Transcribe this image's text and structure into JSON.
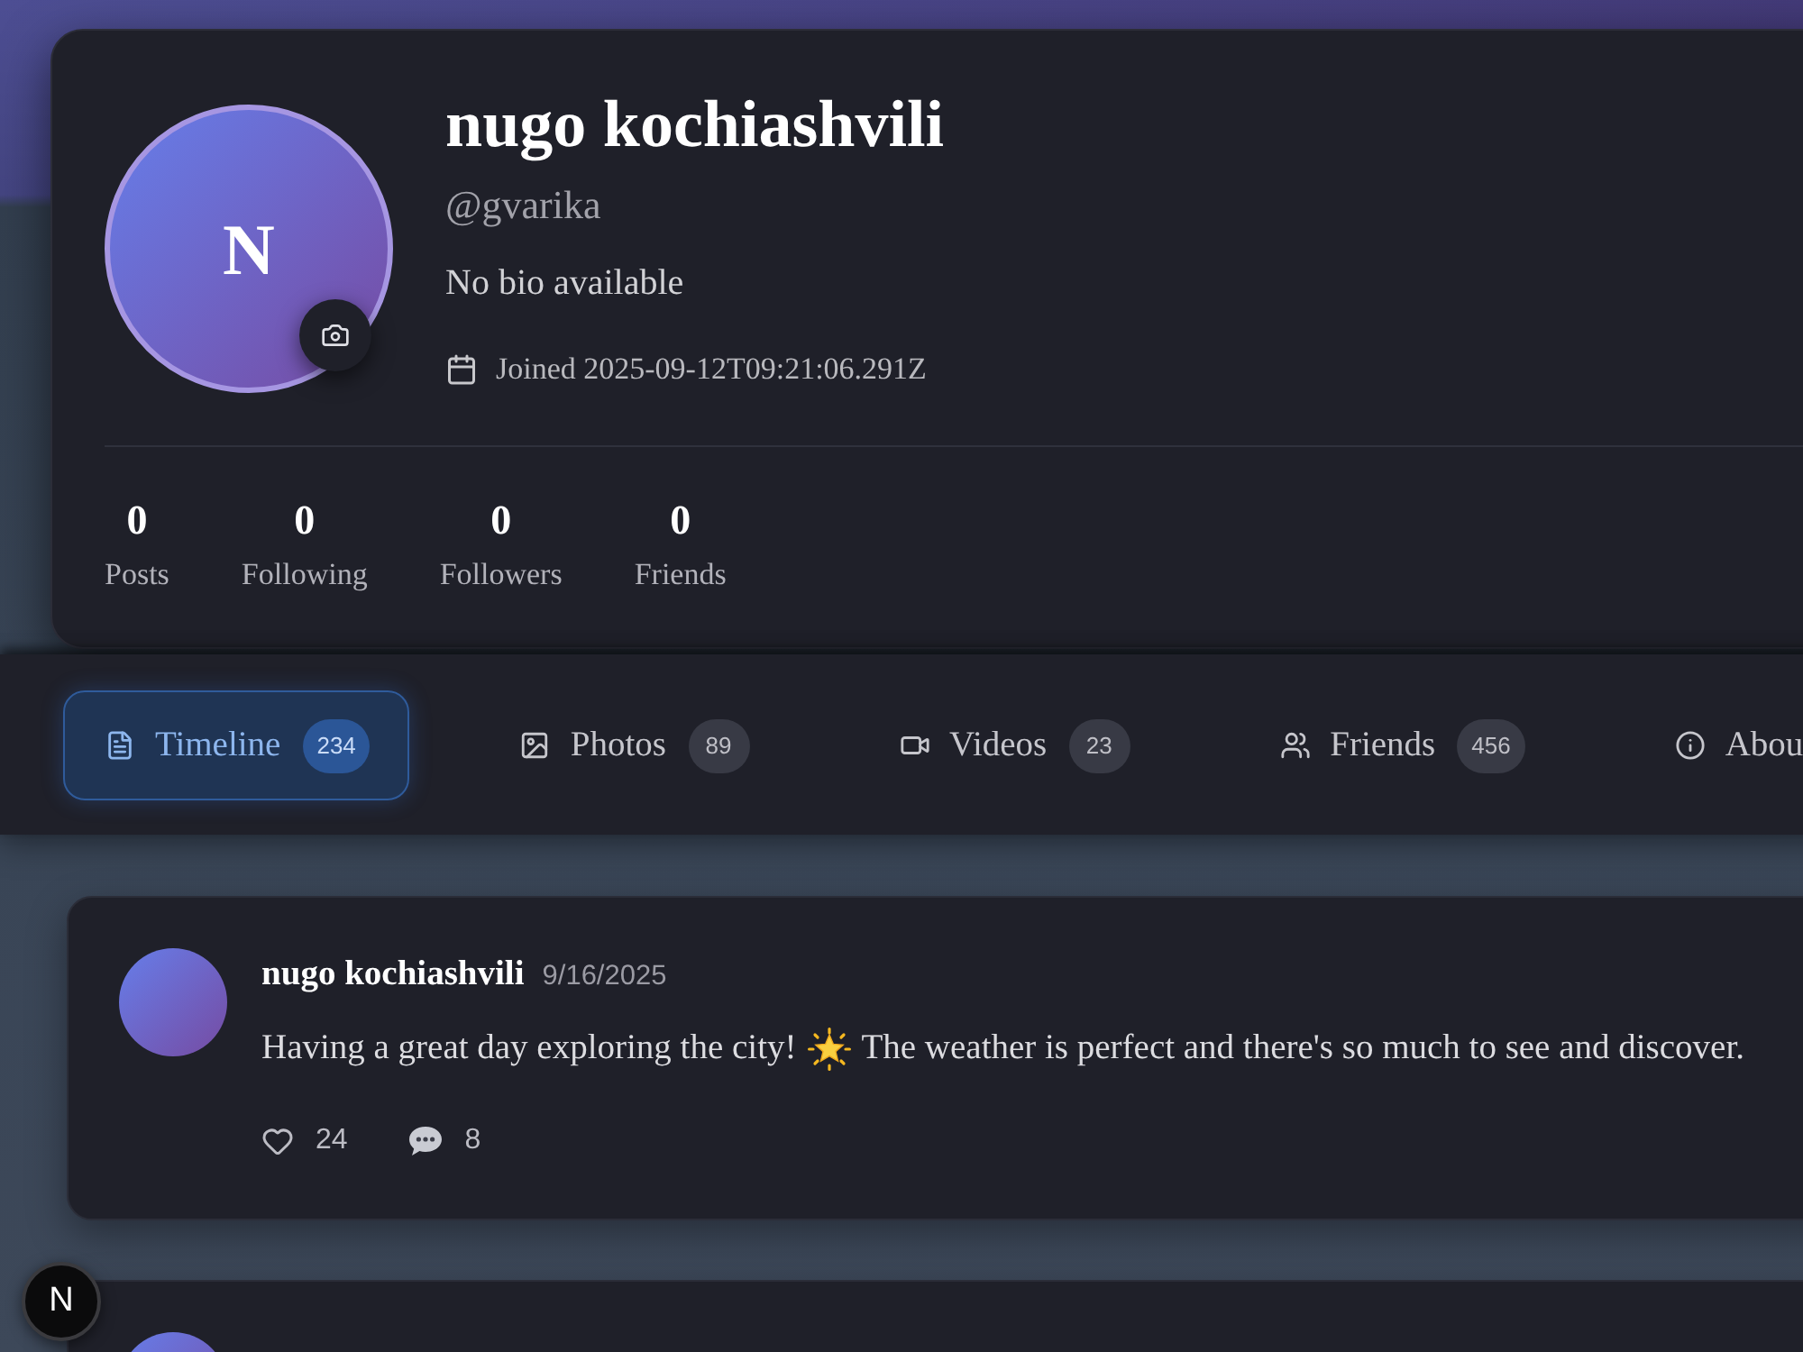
{
  "profile": {
    "avatar_initial": "N",
    "name": "nugo kochiashvili",
    "handle": "@gvarika",
    "bio": "No bio available",
    "joined": "Joined 2025-09-12T09:21:06.291Z",
    "stats": [
      {
        "value": "0",
        "label": "Posts"
      },
      {
        "value": "0",
        "label": "Following"
      },
      {
        "value": "0",
        "label": "Followers"
      },
      {
        "value": "0",
        "label": "Friends"
      }
    ]
  },
  "tabs": [
    {
      "label": "Timeline",
      "count": "234",
      "selected": true
    },
    {
      "label": "Photos",
      "count": "89",
      "selected": false
    },
    {
      "label": "Videos",
      "count": "23",
      "selected": false
    },
    {
      "label": "Friends",
      "count": "456",
      "selected": false
    },
    {
      "label": "Abou",
      "selected": false
    }
  ],
  "posts": [
    {
      "kind": "full",
      "author": "nugo kochiashvili",
      "date": "9/16/2025",
      "text_parts": [
        "Having a great day exploring the city!",
        "The weather is perfect and there's so much to see and discover."
      ],
      "likes": "24",
      "comments": "8"
    },
    {
      "kind": "partial"
    }
  ],
  "dev_badge": {
    "label": "N"
  }
}
